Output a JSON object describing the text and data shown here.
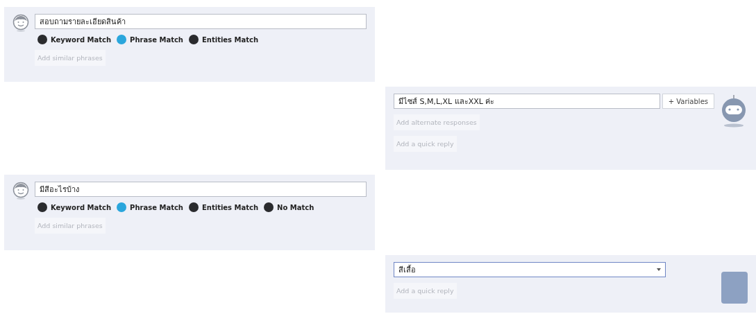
{
  "messages": [
    {
      "kind": "user",
      "text": "สอบถามรายละเอียดสินค้า",
      "matches": [
        {
          "label": "Keyword Match",
          "selected": false
        },
        {
          "label": "Phrase Match",
          "selected": true
        },
        {
          "label": "Entities Match",
          "selected": false
        }
      ],
      "links": [
        "Add similar phrases"
      ]
    },
    {
      "kind": "bot",
      "text": "มีไซส์ S,M,L,XL และXXL ค่ะ",
      "button": "+ Variables",
      "links": [
        "Add alternate responses",
        "Add a quick reply"
      ]
    },
    {
      "kind": "user",
      "text": "มีสีอะไรบ้าง",
      "matches": [
        {
          "label": "Keyword Match",
          "selected": false
        },
        {
          "label": "Phrase Match",
          "selected": true
        },
        {
          "label": "Entities Match",
          "selected": false
        },
        {
          "label": "No Match",
          "selected": false
        }
      ],
      "links": [
        "Add similar phrases"
      ]
    },
    {
      "kind": "select",
      "text": "สีเสื้อ",
      "links": [
        "Add a quick reply"
      ]
    }
  ]
}
